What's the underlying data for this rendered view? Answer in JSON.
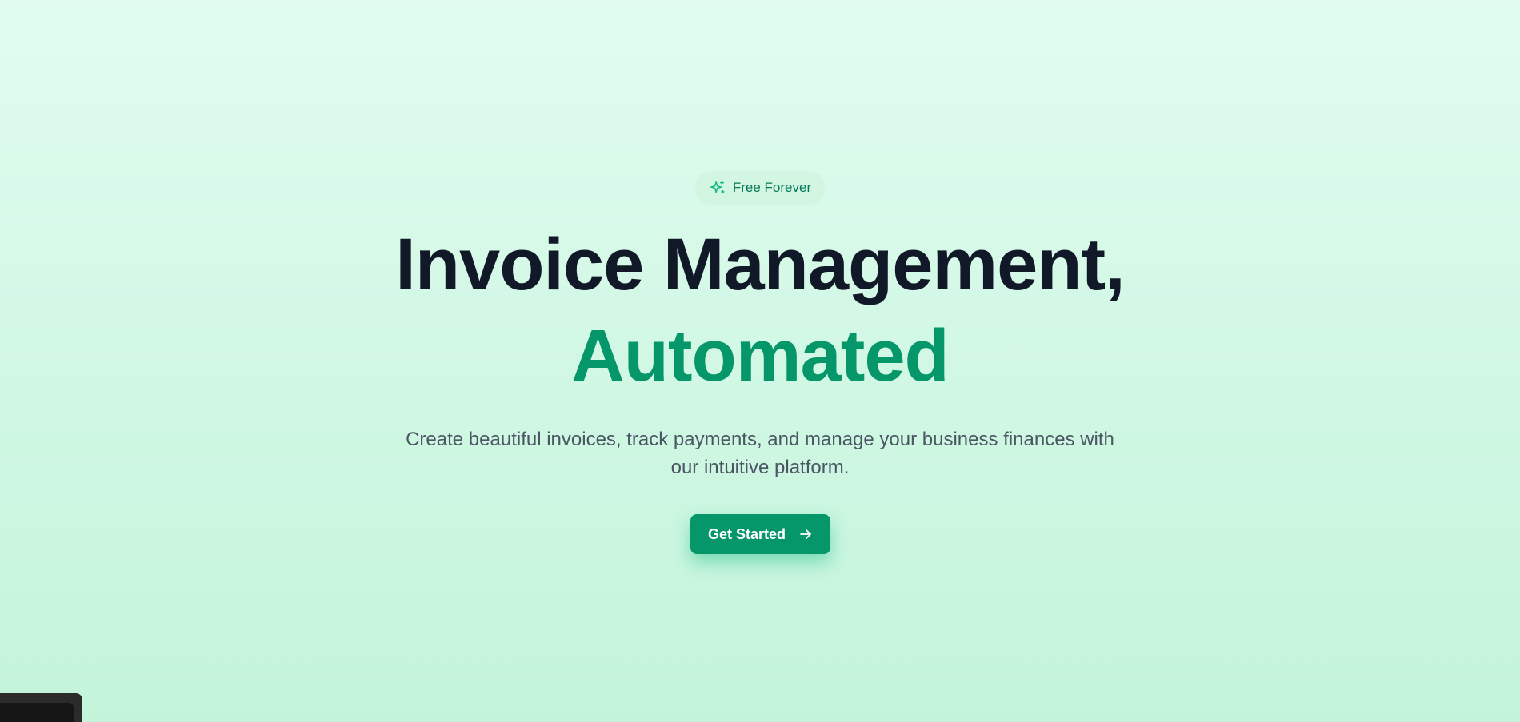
{
  "badge": {
    "icon": "sparkles-icon",
    "label": "Free Forever"
  },
  "hero": {
    "title_line1": "Invoice Management,",
    "title_line2": "Automated",
    "subtitle": "Create beautiful invoices, track payments, and manage your business finances with our intuitive platform."
  },
  "cta": {
    "label": "Get Started",
    "icon": "arrow-right-icon"
  },
  "colors": {
    "accent": "#059669",
    "heading": "#111827",
    "body_text": "#4b5563",
    "badge_text": "#047857"
  }
}
